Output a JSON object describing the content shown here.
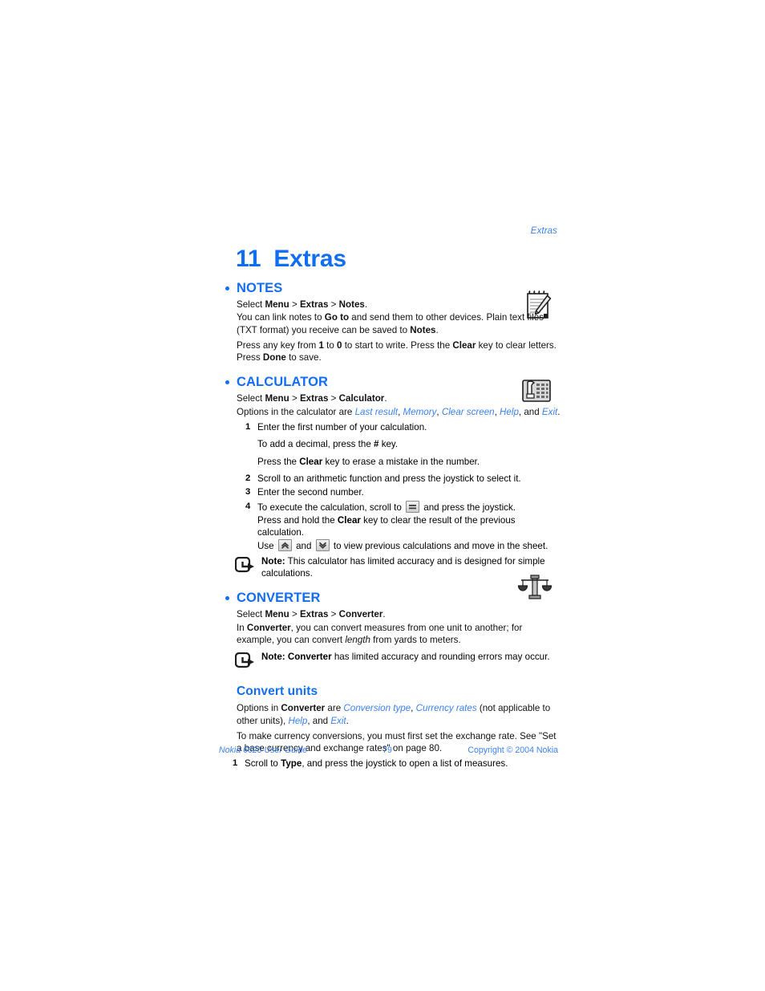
{
  "page": {
    "running_header": "Extras",
    "chapter_number": "11",
    "chapter_title": "Extras",
    "accent_color": "#126ef0",
    "link_color": "#3c82f0"
  },
  "sections": {
    "notes": {
      "heading": "NOTES",
      "icon": "notepad-pencil-icon",
      "p1_prefix": "Select ",
      "p1_menu": "Menu",
      "p1_gt1": " > ",
      "p1_extras": "Extras",
      "p1_gt2": " > ",
      "p1_notes": "Notes",
      "p1_end": ".",
      "p2_a": "You can link notes to ",
      "p2_goto": "Go to",
      "p2_b": " and send them to other devices. Plain text files (TXT format) you receive can be saved to ",
      "p2_notes": "Notes",
      "p2_end": ".",
      "p3_a": "Press any key from ",
      "p3_one": "1",
      "p3_b": " to ",
      "p3_zero": "0",
      "p3_c": " to start to write. Press the ",
      "p3_clear": "Clear",
      "p3_d": " key to clear letters. Press ",
      "p3_done": "Done",
      "p3_e": " to save."
    },
    "calculator": {
      "heading": "CALCULATOR",
      "icon": "calculator-icon",
      "p1_prefix": "Select ",
      "p1_menu": "Menu",
      "p1_gt1": " > ",
      "p1_extras": "Extras",
      "p1_gt2": " > ",
      "p1_calculator": "Calculator",
      "p1_end": ".",
      "p2_a": "Options in the calculator are ",
      "p2_opt1": "Last result",
      "p2_c1": ", ",
      "p2_opt2": "Memory",
      "p2_c2": ", ",
      "p2_opt3": "Clear screen",
      "p2_c3": ", ",
      "p2_opt4": "Help",
      "p2_c4": ", and ",
      "p2_opt5": "Exit",
      "p2_end": ".",
      "steps": {
        "n1": "1",
        "s1": "Enter the first number of your calculation.",
        "s1a_a": "To add a decimal, press the ",
        "s1a_hash": "#",
        "s1a_b": " key.",
        "s1b_a": "Press the ",
        "s1b_clear": "Clear",
        "s1b_b": " key to erase a mistake in the number.",
        "n2": "2",
        "s2": "Scroll to an arithmetic function and press the joystick to select it.",
        "n3": "3",
        "s3": "Enter the second number.",
        "n4": "4",
        "s4_a": "To execute the calculation, scroll to ",
        "s4_icon": "equals-key-icon",
        "s4_b": " and press the joystick.",
        "s4a_a": "Press and hold the ",
        "s4a_clear": "Clear",
        "s4a_b": " key to clear the result of the previous calculation.",
        "s4b_a": "Use ",
        "s4b_icon_up": "scroll-up-key-icon",
        "s4b_and": " and ",
        "s4b_icon_down": "scroll-down-key-icon",
        "s4b_b": " to view previous calculations and move in the sheet."
      },
      "note": {
        "icon": "note-pointer-icon",
        "label": "Note:",
        "text": " This calculator has limited accuracy and is designed for simple calculations."
      }
    },
    "converter": {
      "heading": "CONVERTER",
      "icon": "balance-scale-icon",
      "p1_prefix": "Select ",
      "p1_menu": "Menu",
      "p1_gt1": " > ",
      "p1_extras": "Extras",
      "p1_gt2": " > ",
      "p1_converter": "Converter",
      "p1_end": ".",
      "p2_a": "In ",
      "p2_converter": "Converter",
      "p2_b": ", you can convert measures from one unit to another; for example, you can convert ",
      "p2_length": "length",
      "p2_c": " from yards to meters.",
      "note": {
        "icon": "note-pointer-icon",
        "label": "Note: Converter",
        "text": " has limited accuracy and rounding errors may occur."
      }
    },
    "convert_units": {
      "heading": "Convert units",
      "p1_a": "Options in ",
      "p1_converter": "Converter",
      "p1_b": " are ",
      "p1_opt1": "Conversion type",
      "p1_c1": ", ",
      "p1_opt2": "Currency rates",
      "p1_c2": " (not applicable to other units), ",
      "p1_opt3": "Help",
      "p1_c3": ", and ",
      "p1_opt4": "Exit",
      "p1_end": ".",
      "p2": "To make currency conversions, you must first set the exchange rate. See \"Set a base currency and exchange rates\" on page 80.",
      "step_n1": "1",
      "step_s1_a": "Scroll to ",
      "step_s1_type": "Type",
      "step_s1_b": ", and press the joystick to open a list of measures."
    }
  },
  "footer": {
    "left": "Nokia 6620 User Guide",
    "page_number": "79",
    "right": "Copyright © 2004 Nokia"
  }
}
